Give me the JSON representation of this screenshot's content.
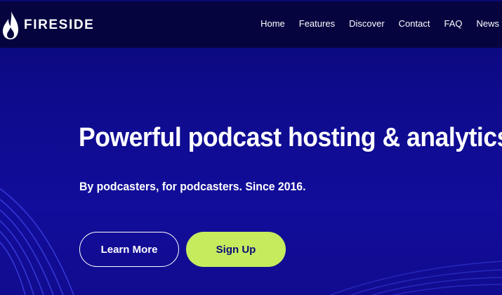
{
  "brand": {
    "name": "FIRESIDE",
    "icon": "flame-icon"
  },
  "nav": {
    "items": [
      "Home",
      "Features",
      "Discover",
      "Contact",
      "FAQ",
      "News"
    ]
  },
  "hero": {
    "title": "Powerful podcast hosting & analytics",
    "subtitle": "By podcasters, for podcasters. Since 2016."
  },
  "buttons": {
    "learn_more": "Learn More",
    "sign_up": "Sign Up"
  },
  "colors": {
    "navbar": "#05043f",
    "hero_background": "#0e0b8c",
    "accent": "#c6ec5e",
    "text": "#ffffff"
  }
}
